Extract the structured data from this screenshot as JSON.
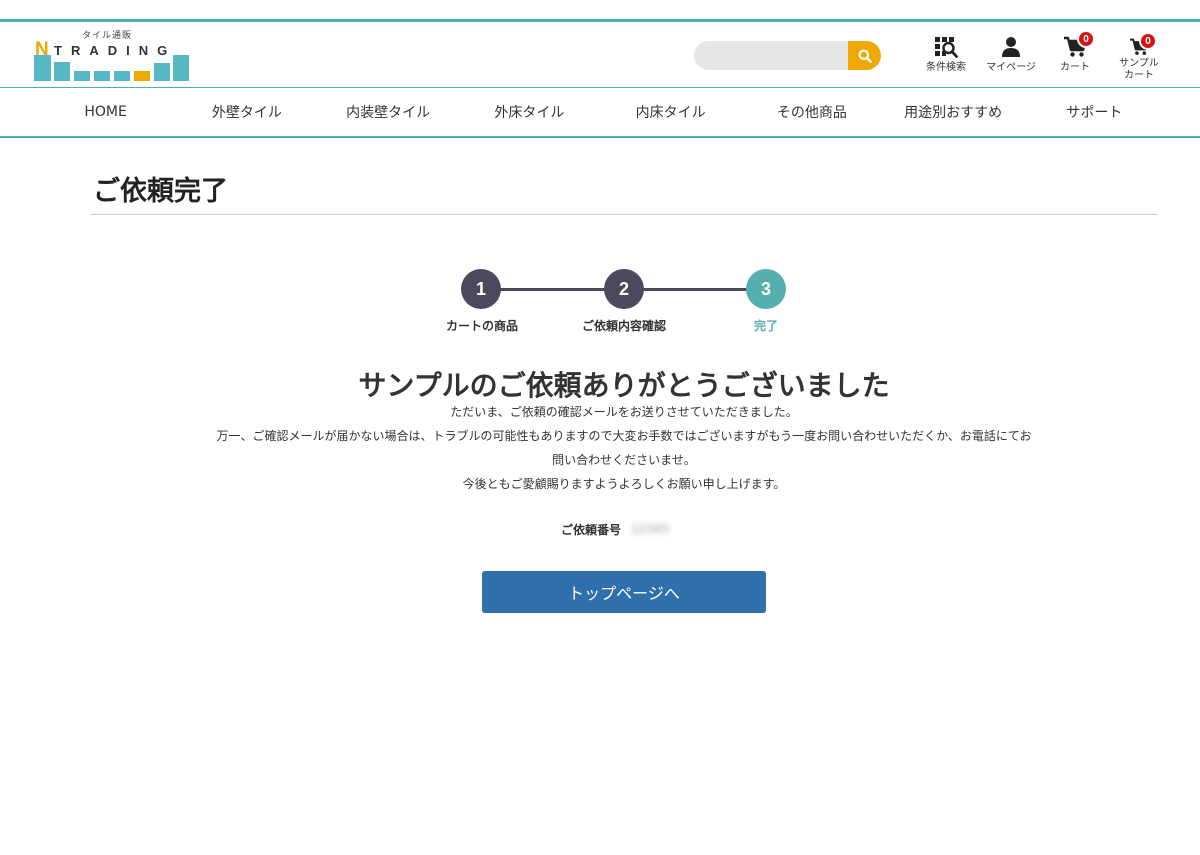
{
  "header": {
    "logo": {
      "subtitle": "タイル通販",
      "initial": "N",
      "word": "TRADING"
    },
    "search": {
      "value": "",
      "placeholder": "",
      "button_icon": "search-icon"
    },
    "icons": [
      {
        "name": "condition-search",
        "label": "条件検索",
        "icon": "grid-search-icon"
      },
      {
        "name": "mypage",
        "label": "マイページ",
        "icon": "user-icon"
      },
      {
        "name": "cart",
        "label": "カート",
        "icon": "cart-icon",
        "count": "0"
      },
      {
        "name": "sample-cart",
        "label_line1": "サンプル",
        "label_line2": "カート",
        "icon": "cart-icon",
        "count": "0"
      }
    ]
  },
  "nav": {
    "items": [
      {
        "label": "HOME"
      },
      {
        "label": "外壁タイル"
      },
      {
        "label": "内装壁タイル"
      },
      {
        "label": "外床タイル"
      },
      {
        "label": "内床タイル"
      },
      {
        "label": "その他商品"
      },
      {
        "label": "用途別おすすめ"
      },
      {
        "label": "サポート"
      }
    ]
  },
  "page": {
    "title": "ご依頼完了",
    "steps": [
      {
        "number": "1",
        "label": "カートの商品",
        "active": false
      },
      {
        "number": "2",
        "label": "ご依頼内容確認",
        "active": false
      },
      {
        "number": "3",
        "label": "完了",
        "active": true
      }
    ],
    "thanks_heading": "サンプルのご依頼ありがとうございました",
    "messages": [
      "ただいま、ご依頼の確認メールをお送りさせていただきました。",
      "万一、ご確認メールが届かない場合は、トラブルの可能性もありますので大変お手数ではございますがもう一度お問い合わせいただくか、お電話にてお",
      "問い合わせくださいませ。",
      "今後ともご愛顧賜りますようよろしくお願い申し上げます。"
    ],
    "order_label": "ご依頼番号",
    "order_number": "12345",
    "top_button_label": "トップページへ"
  },
  "colors": {
    "accent_teal": "#4fb0b6",
    "logo_orange": "#f0a800",
    "step_dark": "#4a4a5c",
    "step_active": "#55b0ad",
    "button_blue": "#2f6fab",
    "badge_red": "#d5141a"
  }
}
